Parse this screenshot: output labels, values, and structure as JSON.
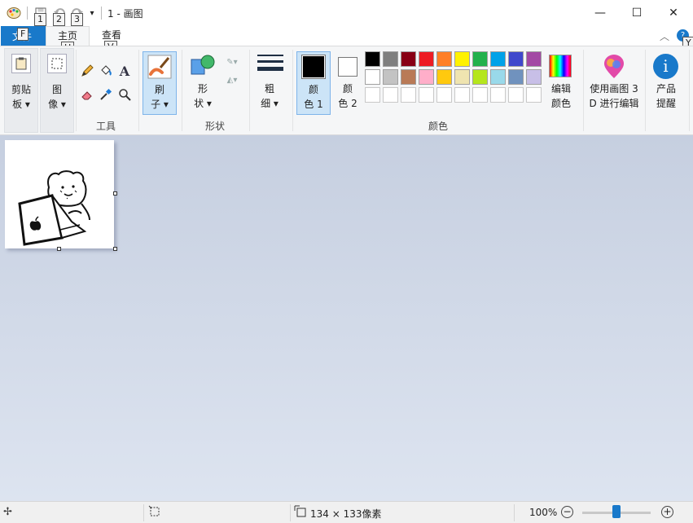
{
  "window": {
    "title": "1 - 画图",
    "minimize_glyph": "—",
    "maximize_glyph": "☐",
    "close_glyph": "✕"
  },
  "quick_access": {
    "keytips": [
      "1",
      "2",
      "3"
    ],
    "icons": [
      "paint-app-icon",
      "save-icon",
      "undo-icon",
      "redo-icon",
      "customize-dropdown-icon"
    ]
  },
  "tabs": {
    "file": {
      "label": "文件",
      "keytip": "F"
    },
    "home": {
      "label": "主页",
      "keytip": "H"
    },
    "view": {
      "label": "查看",
      "keytip": "V"
    },
    "help_keytip": "Y"
  },
  "ribbon": {
    "clipboard": {
      "label_line1": "剪贴",
      "label_line2": "板 ▾"
    },
    "image": {
      "label_line1": "图",
      "label_line2": "像 ▾"
    },
    "tools": {
      "group_label": "工具"
    },
    "brushes": {
      "label_line1": "刷",
      "label_line2": "子 ▾"
    },
    "shapes": {
      "label_line1": "形",
      "label_line2": "状 ▾",
      "group_label": "形状"
    },
    "size": {
      "label_line1": "粗",
      "label_line2": "细 ▾"
    },
    "color1": {
      "label_line1": "颜",
      "label_line2": "色 1",
      "color": "#000000"
    },
    "color2": {
      "label_line1": "颜",
      "label_line2": "色 2",
      "color": "#ffffff"
    },
    "colors_group_label": "颜色",
    "edit_colors": {
      "label_line1": "编辑",
      "label_line2": "颜色"
    },
    "paint3d": {
      "label_line1": "使用画图 3",
      "label_line2": "D 进行编辑"
    },
    "product_alert": {
      "label_line1": "产品",
      "label_line2": "提醒"
    }
  },
  "palette": {
    "row1": [
      "#000000",
      "#7f7f7f",
      "#880015",
      "#ed1c24",
      "#ff7f27",
      "#fff200",
      "#22b14c",
      "#00a2e8",
      "#3f48cc",
      "#a349a4"
    ],
    "row2": [
      "#ffffff",
      "#c3c3c3",
      "#b97a57",
      "#ffaec9",
      "#ffc90e",
      "#efe4b0",
      "#b5e61d",
      "#99d9ea",
      "#7092be",
      "#c8bfe7"
    ],
    "row3": [
      "#ffffff",
      "#ffffff",
      "#ffffff",
      "#ffffff",
      "#ffffff",
      "#ffffff",
      "#ffffff",
      "#ffffff",
      "#ffffff",
      "#ffffff"
    ]
  },
  "statusbar": {
    "image_size": "134 × 133像素",
    "zoom": "100%",
    "zoom_level": 1.0
  }
}
